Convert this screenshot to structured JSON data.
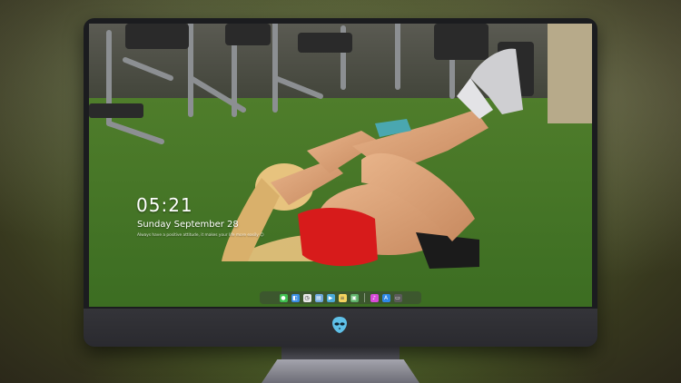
{
  "lock_screen": {
    "time": "05:21",
    "date": "Sunday September  28",
    "quote": "Always have a positive attitude, it makes your life more easily ☺"
  },
  "dock": {
    "icons": [
      {
        "name": "messages-icon",
        "color": "#3fbf4f",
        "glyph": "●"
      },
      {
        "name": "finder-icon",
        "color": "#3a8ee6",
        "glyph": "◧"
      },
      {
        "name": "clock-icon",
        "color": "#e8e8e8",
        "glyph": "◷"
      },
      {
        "name": "preview-icon",
        "color": "#6fa8dc",
        "glyph": "▤"
      },
      {
        "name": "video-icon",
        "color": "#4aa9d8",
        "glyph": "▶"
      },
      {
        "name": "notes-icon",
        "color": "#f4d35e",
        "glyph": "≡"
      },
      {
        "name": "photos-icon",
        "color": "#5fb36a",
        "glyph": "▣"
      },
      {
        "name": "music-icon",
        "color": "#d84ad8",
        "glyph": "♪"
      },
      {
        "name": "app-store-icon",
        "color": "#2e88e8",
        "glyph": "A"
      },
      {
        "name": "display-icon",
        "color": "#5a5a5a",
        "glyph": "▭"
      }
    ]
  }
}
